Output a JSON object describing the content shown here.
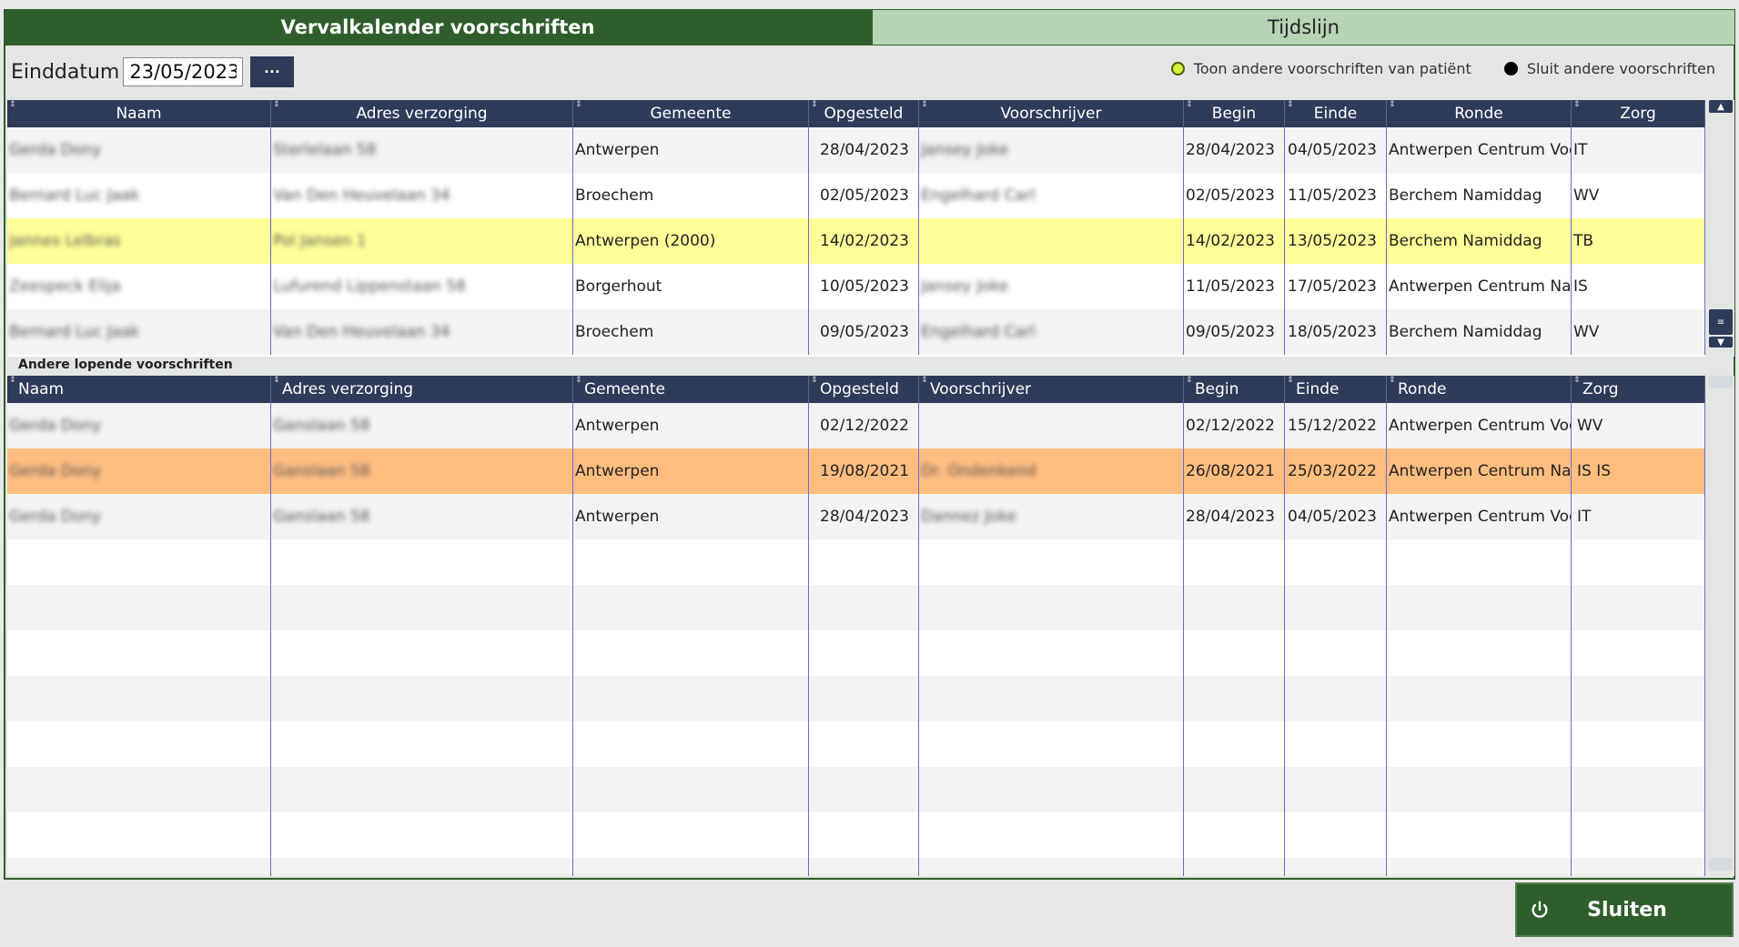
{
  "tabs": {
    "active": "Vervalkalender voorschriften",
    "inactive": "Tijdslijn"
  },
  "toolbar": {
    "einddatum_label": "Einddatum",
    "einddatum_value": "23/05/2023",
    "more_button": "···",
    "radio_show": "Toon andere voorschriften van patiënt",
    "radio_close": "Sluit andere voorschriften"
  },
  "columns": [
    "Naam",
    "Adres verzorging",
    "Gemeente",
    "Opgesteld",
    "Voorschrijver",
    "Begin",
    "Einde",
    "Ronde",
    "Zorg"
  ],
  "top_rows": [
    {
      "naam": "Gerda Dony",
      "adres": "Sterlelaan 58",
      "gemeente": "Antwerpen",
      "opgesteld": "28/04/2023",
      "voorschrijver": "Jansey Joke",
      "begin": "28/04/2023",
      "einde": "04/05/2023",
      "ronde": "Antwerpen Centrum Voo",
      "zorg": "IT"
    },
    {
      "naam": "Bernard Luc Jaak",
      "adres": "Van Den Heuvelaan 34",
      "gemeente": "Broechem",
      "opgesteld": "02/05/2023",
      "voorschrijver": "Engelhard Carl",
      "begin": "02/05/2023",
      "einde": "11/05/2023",
      "ronde": "Berchem Namiddag",
      "zorg": "WV"
    },
    {
      "naam": "Jannes Lelbras",
      "adres": "Pol Jansen 1",
      "gemeente": "Antwerpen (2000)",
      "opgesteld": "14/02/2023",
      "voorschrijver": "",
      "begin": "14/02/2023",
      "einde": "13/05/2023",
      "ronde": "Berchem Namiddag",
      "zorg": "TB"
    },
    {
      "naam": "Zeespeck Elija",
      "adres": "Lufurend Lippenstaan 58",
      "gemeente": "Borgerhout",
      "opgesteld": "10/05/2023",
      "voorschrijver": "Jansey Joke",
      "begin": "11/05/2023",
      "einde": "17/05/2023",
      "ronde": "Antwerpen Centrum Nan",
      "zorg": "IS"
    },
    {
      "naam": "Bernard Luc Jaak",
      "adres": "Van Den Heuvelaan 34",
      "gemeente": "Broechem",
      "opgesteld": "09/05/2023",
      "voorschrijver": "Engelhard Carl",
      "begin": "09/05/2023",
      "einde": "18/05/2023",
      "ronde": "Berchem Namiddag",
      "zorg": "WV"
    }
  ],
  "section_label": "Andere lopende voorschriften",
  "bottom_rows": [
    {
      "naam": "Gerda Dony",
      "adres": "Ganslaan 58",
      "gemeente": "Antwerpen",
      "opgesteld": "02/12/2022",
      "voorschrijver": "",
      "begin": "02/12/2022",
      "einde": "15/12/2022",
      "ronde": "Antwerpen Centrum Voo",
      "zorg": "WV"
    },
    {
      "naam": "Gerda Dony",
      "adres": "Ganslaan 58",
      "gemeente": "Antwerpen",
      "opgesteld": "19/08/2021",
      "voorschrijver": "Dr. Ondenkend",
      "begin": "26/08/2021",
      "einde": "25/03/2022",
      "ronde": "Antwerpen Centrum Nan",
      "zorg": "IS IS"
    },
    {
      "naam": "Gerda Dony",
      "adres": "Ganslaan 58",
      "gemeente": "Antwerpen",
      "opgesteld": "28/04/2023",
      "voorschrijver": "Dannez Joke",
      "begin": "28/04/2023",
      "einde": "04/05/2023",
      "ronde": "Antwerpen Centrum Voo",
      "zorg": "IT"
    }
  ],
  "close_button": "Sluiten",
  "colors": {
    "header": "#2e3b59",
    "tab_active": "#2f5e2c",
    "highlight_yellow": "#ffff99",
    "highlight_orange": "#ffbd80"
  }
}
